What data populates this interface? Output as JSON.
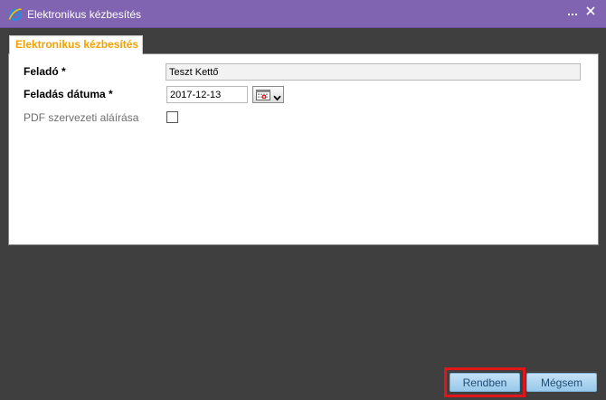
{
  "window": {
    "title": "Elektronikus kézbesítés",
    "icon": "ie-icon"
  },
  "tab": {
    "label": "Elektronikus kézbesítés"
  },
  "form": {
    "sender_label": "Feladó *",
    "sender_value": "Teszt Kettő",
    "date_label": "Feladás dátuma *",
    "date_value": "2017-12-13",
    "pdf_label": "PDF szervezeti aláírása",
    "pdf_checked": false
  },
  "buttons": {
    "ok_label": "Rendben",
    "cancel_label": "Mégsem"
  },
  "colors": {
    "titlebar": "#8064b2",
    "tab_text": "#f2a100",
    "background": "#3f3f3f",
    "highlight": "#e0161b",
    "button": "#98c9ea"
  }
}
